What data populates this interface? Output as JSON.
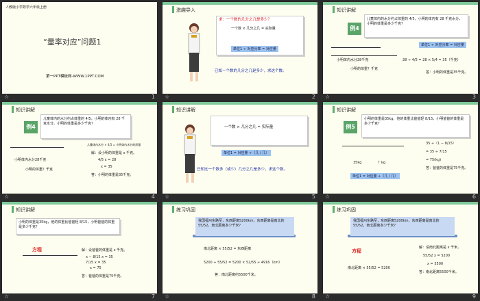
{
  "slides": [
    {
      "number": "1",
      "subject": "人教版小学数学六年级上册",
      "title": "“量率对应”问题1",
      "website": "第一PPT模板网-WWW.1PPT.COM"
    },
    {
      "number": "2",
      "section": "激趣导入",
      "prompt": "求：一个数的几分之几是多少？",
      "formula": "一个数 × 几分之几 = 实际量",
      "step": "单位1 ÷ 对应分率 = 对应量",
      "caption": "已知一个数的几分之几是多少，求这个数。"
    },
    {
      "number": "3",
      "section": "知识讲解",
      "example": "例4",
      "problem": "儿童体内的水分约占体重的 4/5，小明的体内有 28 千克水分，小明的体重是多少千克？",
      "diagram_label": "小明体内水分28千克",
      "question": "小明的体重？千克",
      "step": "单位1 ÷ 对应分率 = 对应量",
      "calc": "28 ÷ 4/5 = 28 × 5/4 = 35（千克）",
      "answer": "答：小明的体重是35千克。"
    },
    {
      "number": "4",
      "section": "知识讲解",
      "example": "例4",
      "problem": "儿童体内的水分约占体重的 4/5，小明的体内有 28 千克水分。小明的体重是多少千克？",
      "rel": "儿童体内水分 × 4/5 = 小明体内水分的质量",
      "solve_intro": "解：设小明的体重是 x 千克。",
      "eq1": "4/5 x = 28",
      "eq2": "x = 35",
      "answer": "答：小明的体重是35千克。",
      "diagram_label": "小明体内水分28千克",
      "question": "小明的体重？千克"
    },
    {
      "number": "5",
      "section": "知识讲解",
      "formula": "一个数 × 几分之几 = 实际量",
      "step": "单位1 = 对应量 ÷（几 / 几）",
      "caption": "已知比一个数多（或少）几分之几是多少，求这个数。"
    },
    {
      "number": "6",
      "section": "知识讲解",
      "example": "例5",
      "problem": "小明的体重是35kg，他的体重比爸爸轻 8/15，小明爸爸的体重是多少千克？",
      "calc1": "35 ÷（1 − 8/15）",
      "calc2": "= 35 ÷ 7/15",
      "calc3": "= 75(kg)",
      "answer": "答：爸爸的体重是75千克。",
      "label1": "35kg",
      "label2": "？kg",
      "step": "单位1 = 对应量 ÷（几 / 几）"
    },
    {
      "number": "7",
      "section": "知识讲解",
      "problem": "小明的体重是35kg，他的体重比爸爸轻 8/15，小明爸爸的体重是多少千克？",
      "method": "方程",
      "solve_intro": "解：设爸爸的体重是 x 千克。",
      "eq0": "x − 8/15 x = 35",
      "eq1": "7/15 x = 35",
      "eq2": "x = 75",
      "answer": "答：爸爸的体重是75千克。"
    },
    {
      "number": "8",
      "section": "练习巩固",
      "problem": "我国福州东路至，东西距离5200km，东西距离是南北的 55/52，南北距离多少千米？",
      "rel": "南北距离 × 55/52 = 东西距离",
      "calc": "5200 ÷ 55/52 = 5200 × 52/55 ≈ 4916（km）",
      "answer": "答：南北距离约5500千米。"
    },
    {
      "number": "9",
      "section": "练习巩固",
      "problem": "我国福州东路至，东西距离5200km，东西距离是南北的 55/52，南北距离多少千米？",
      "method": "方程",
      "rel": "南北距离 × 55/52 = 5200",
      "solve_intro": "解：设南北距离是 x 千米。",
      "eq1": "55/52 x = 5200",
      "eq2": "x = 5500",
      "answer": "答：南北距离5500千米。"
    }
  ],
  "label_left": "☆",
  "colors": {
    "accent": "#5aa468",
    "band": "#c8d9f3",
    "shelf": "#6d8fc6"
  }
}
